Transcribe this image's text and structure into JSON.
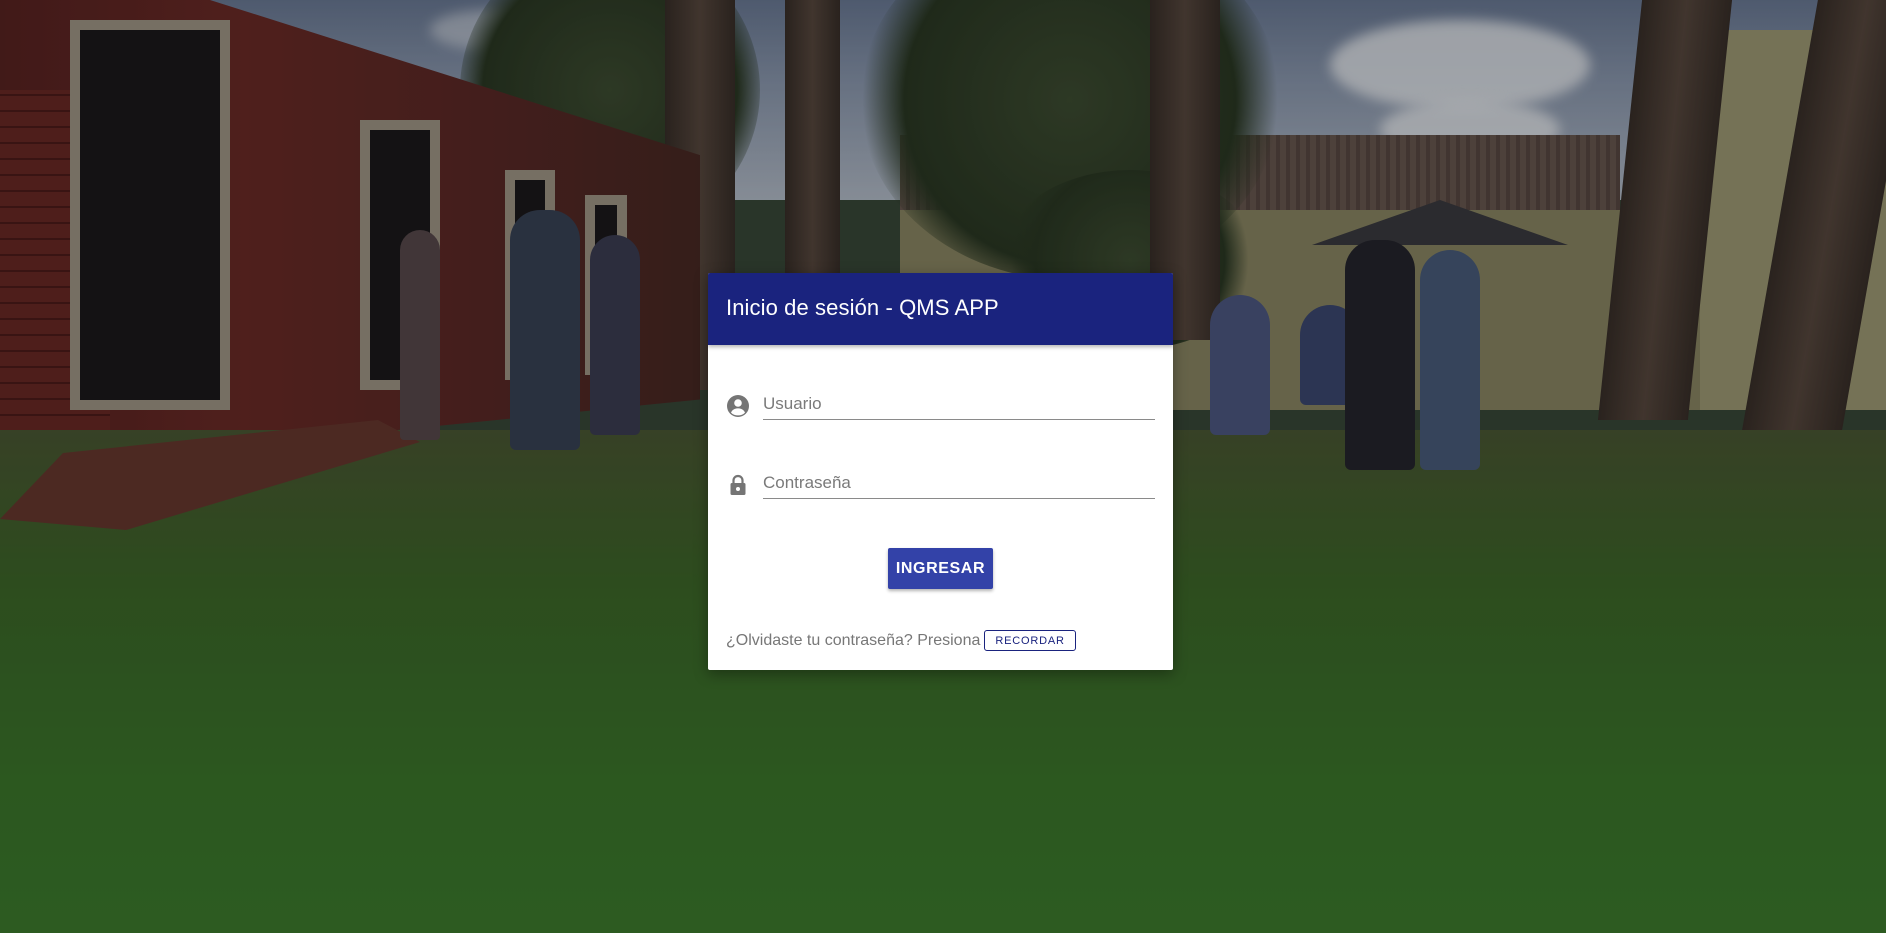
{
  "login": {
    "title": "Inicio de sesión - QMS APP",
    "username_placeholder": "Usuario",
    "username_icon": "account-circle-icon",
    "password_placeholder": "Contraseña",
    "password_icon": "lock-icon",
    "submit_label": "INGRESAR",
    "forgot_text": "¿Olvidaste tu contraseña? Presiona",
    "remember_label": "RECORDAR"
  },
  "colors": {
    "header": "#1a237e",
    "primary_button": "#3342a8",
    "card_background": "#ffffff"
  }
}
